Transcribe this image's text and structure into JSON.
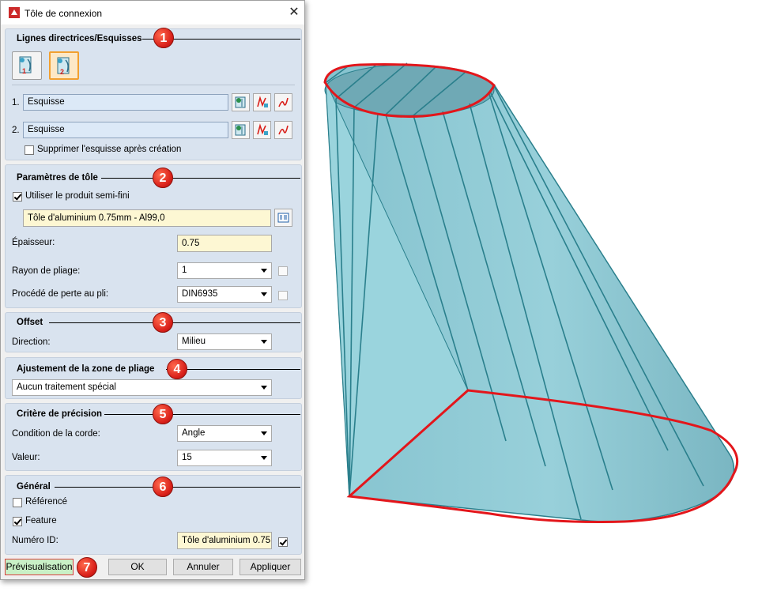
{
  "window": {
    "title": "Tôle de connexion",
    "close_glyph": "✕"
  },
  "badges": [
    "1",
    "2",
    "3",
    "4",
    "5",
    "6",
    "7"
  ],
  "guidelines": {
    "heading": "Lignes directrices/Esquisses",
    "mode_buttons": [
      {
        "icon": "guideline-mode-1-icon",
        "number": "1"
      },
      {
        "icon": "guideline-mode-2-icon",
        "number": "2",
        "selected": true
      }
    ],
    "rows": [
      {
        "index": "1.",
        "value": "Esquisse"
      },
      {
        "index": "2.",
        "value": "Esquisse"
      }
    ],
    "delete_sketch_label": "Supprimer l'esquisse après création"
  },
  "sheet_params": {
    "heading": "Paramètres de tôle",
    "use_semi_finished_label": "Utiliser le produit semi-fini",
    "semi_finished_value": "Tôle d'aluminium 0.75mm - Al99,0",
    "thickness_label": "Épaisseur:",
    "thickness_value": "0.75",
    "bend_radius_label": "Rayon de pliage:",
    "bend_radius_value": "1",
    "bend_loss_label": "Procédé de perte au pli:",
    "bend_loss_value": "DIN6935"
  },
  "offset": {
    "heading": "Offset",
    "direction_label": "Direction:",
    "direction_value": "Milieu"
  },
  "bend_zone": {
    "heading": "Ajustement de la zone de pliage",
    "value": "Aucun traitement spécial"
  },
  "precision": {
    "heading": "Critère de précision",
    "chord_label": "Condition de la corde:",
    "chord_value": "Angle",
    "value_label": "Valeur:",
    "value_value": "15"
  },
  "general": {
    "heading": "Général",
    "referenced_label": "Référencé",
    "feature_label": "Feature",
    "id_label": "Numéro ID:",
    "id_value": "Tôle d'aluminium 0.75"
  },
  "buttons": {
    "preview": "Prévisualisation",
    "ok": "OK",
    "cancel": "Annuler",
    "apply": "Appliquer"
  },
  "colors": {
    "section_bg": "#d9e3ef",
    "badge_red": "#d9201a",
    "shape_fill": "#8ccbd6",
    "shape_outline": "#e3161b",
    "selected_button": "#f2a030"
  }
}
